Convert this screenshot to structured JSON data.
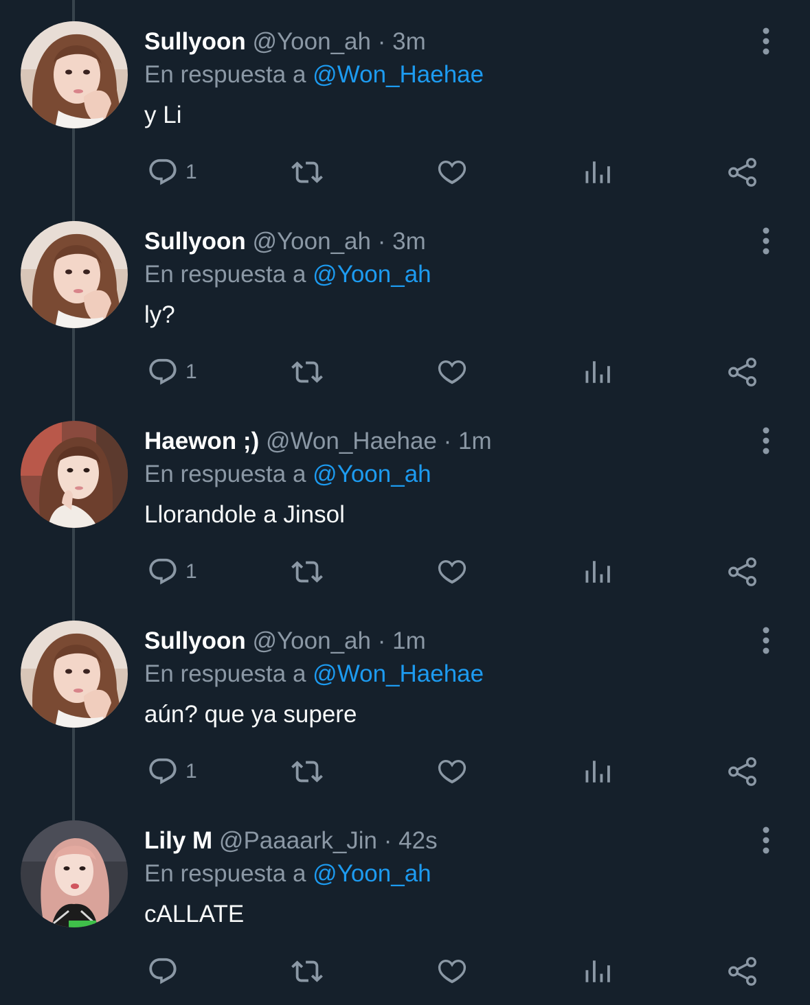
{
  "tweets": [
    {
      "name": "Sullyoon",
      "handle": "@Yoon_ah",
      "separator": "·",
      "time": "3m",
      "reply_prefix": "En respuesta a",
      "reply_to": "@Won_Haehae",
      "text": "y Li",
      "reply_count": "1",
      "avatar": "sullyoon-avatar"
    },
    {
      "name": "Sullyoon",
      "handle": "@Yoon_ah",
      "separator": "·",
      "time": "3m",
      "reply_prefix": "En respuesta a",
      "reply_to": "@Yoon_ah",
      "text": "ly?",
      "reply_count": "1",
      "avatar": "sullyoon-avatar"
    },
    {
      "name": "Haewon ;)",
      "handle": "@Won_Haehae",
      "separator": "·",
      "time": "1m",
      "reply_prefix": "En respuesta a",
      "reply_to": "@Yoon_ah",
      "text": "Llorandole a Jinsol",
      "reply_count": "1",
      "avatar": "haewon-avatar"
    },
    {
      "name": "Sullyoon",
      "handle": "@Yoon_ah",
      "separator": "·",
      "time": "1m",
      "reply_prefix": "En respuesta a",
      "reply_to": "@Won_Haehae",
      "text": "aún? que ya supere",
      "reply_count": "1",
      "avatar": "sullyoon-avatar"
    },
    {
      "name": "Lily M",
      "handle": "@Paaaark_Jin",
      "separator": "·",
      "time": "42s",
      "reply_prefix": "En respuesta a",
      "reply_to": "@Yoon_ah",
      "text": "cALLATE",
      "reply_count": "",
      "avatar": "lily-avatar"
    }
  ],
  "icons": {
    "reply": "reply-icon",
    "retweet": "retweet-icon",
    "like": "like-icon",
    "views": "views-icon",
    "share": "share-icon",
    "more": "more-options-icon"
  },
  "colors": {
    "background": "#15202b",
    "name": "#ffffff",
    "secondary_text": "#8b98a5",
    "mention": "#1d9bf0",
    "thread_line": "#38444d"
  }
}
